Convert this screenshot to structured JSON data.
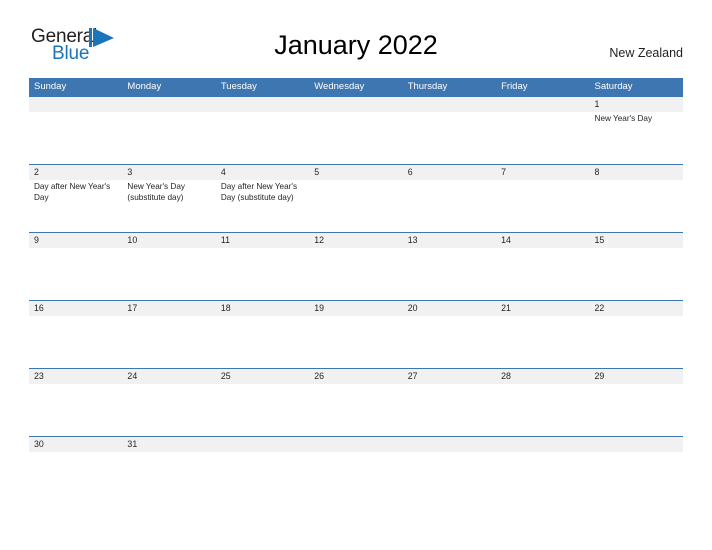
{
  "brand": {
    "name_part1": "General",
    "name_part2": "Blue",
    "flag_icon": "blue-flag-triangle-icon",
    "color_dark": "#231f20",
    "color_blue": "#1b75bb"
  },
  "header": {
    "title": "January 2022",
    "region": "New Zealand"
  },
  "theme": {
    "header_blue": "#3d76b0",
    "date_band_gray": "#f1f1f1",
    "rule_blue": "#3d76b0",
    "text_color": "#231f20",
    "background": "#ffffff"
  },
  "calendar": {
    "weekdays": [
      "Sunday",
      "Monday",
      "Tuesday",
      "Wednesday",
      "Thursday",
      "Friday",
      "Saturday"
    ],
    "weeks": [
      {
        "days": [
          {
            "date": "",
            "note": ""
          },
          {
            "date": "",
            "note": ""
          },
          {
            "date": "",
            "note": ""
          },
          {
            "date": "",
            "note": ""
          },
          {
            "date": "",
            "note": ""
          },
          {
            "date": "",
            "note": ""
          },
          {
            "date": "1",
            "note": "New Year's Day"
          }
        ]
      },
      {
        "days": [
          {
            "date": "2",
            "note": "Day after New Year's Day"
          },
          {
            "date": "3",
            "note": "New Year's Day (substitute day)"
          },
          {
            "date": "4",
            "note": "Day after New Year's Day (substitute day)"
          },
          {
            "date": "5",
            "note": ""
          },
          {
            "date": "6",
            "note": ""
          },
          {
            "date": "7",
            "note": ""
          },
          {
            "date": "8",
            "note": ""
          }
        ]
      },
      {
        "days": [
          {
            "date": "9",
            "note": ""
          },
          {
            "date": "10",
            "note": ""
          },
          {
            "date": "11",
            "note": ""
          },
          {
            "date": "12",
            "note": ""
          },
          {
            "date": "13",
            "note": ""
          },
          {
            "date": "14",
            "note": ""
          },
          {
            "date": "15",
            "note": ""
          }
        ]
      },
      {
        "days": [
          {
            "date": "16",
            "note": ""
          },
          {
            "date": "17",
            "note": ""
          },
          {
            "date": "18",
            "note": ""
          },
          {
            "date": "19",
            "note": ""
          },
          {
            "date": "20",
            "note": ""
          },
          {
            "date": "21",
            "note": ""
          },
          {
            "date": "22",
            "note": ""
          }
        ]
      },
      {
        "days": [
          {
            "date": "23",
            "note": ""
          },
          {
            "date": "24",
            "note": ""
          },
          {
            "date": "25",
            "note": ""
          },
          {
            "date": "26",
            "note": ""
          },
          {
            "date": "27",
            "note": ""
          },
          {
            "date": "28",
            "note": ""
          },
          {
            "date": "29",
            "note": ""
          }
        ]
      },
      {
        "days": [
          {
            "date": "30",
            "note": ""
          },
          {
            "date": "31",
            "note": ""
          },
          {
            "date": "",
            "note": ""
          },
          {
            "date": "",
            "note": ""
          },
          {
            "date": "",
            "note": ""
          },
          {
            "date": "",
            "note": ""
          },
          {
            "date": "",
            "note": ""
          }
        ]
      }
    ]
  }
}
